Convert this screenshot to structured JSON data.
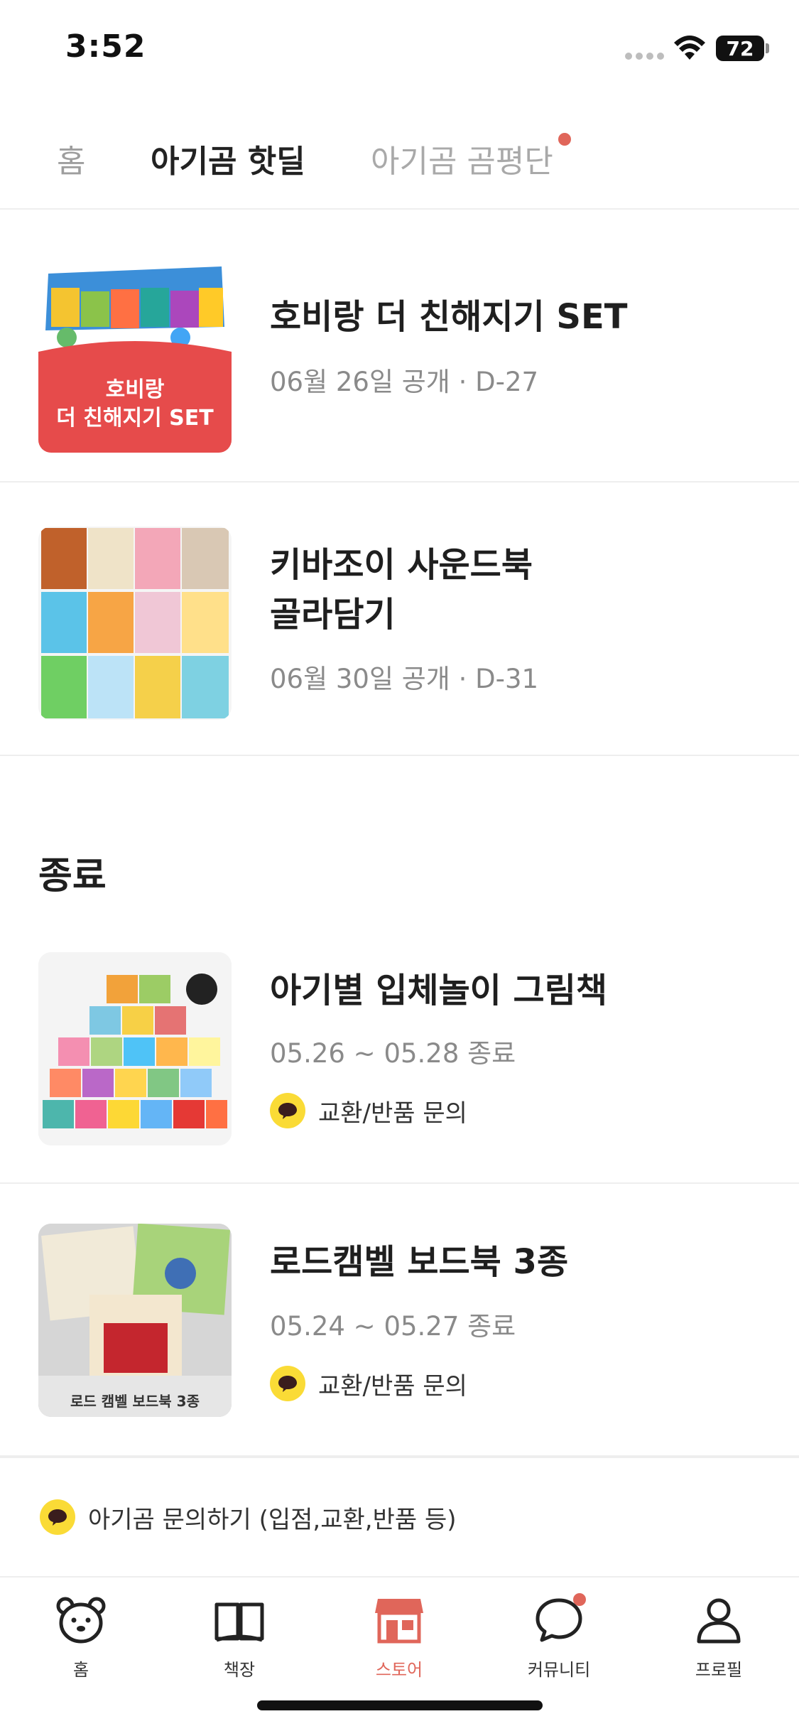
{
  "status": {
    "time": "3:52",
    "battery": "72"
  },
  "tabs": [
    {
      "label": "홈"
    },
    {
      "label": "아기곰 핫딜"
    },
    {
      "label": "아기곰 곰평단"
    }
  ],
  "upcoming": [
    {
      "thumb_text_1": "호비랑",
      "thumb_text_2": "더 친해지기 SET",
      "title": "호비랑 더 친해지기 SET",
      "subtitle": "06월 26일 공개 · D-27"
    },
    {
      "title_line1": "키바조이 사운드북",
      "title_line2": "골라담기",
      "subtitle": "06월 30일 공개 · D-31"
    }
  ],
  "ended_section": {
    "title": "종료"
  },
  "ended": [
    {
      "title": "아기별 입체놀이 그림책",
      "subtitle": "05.26 ~ 05.28 종료",
      "inquiry": "교환/반품 문의"
    },
    {
      "title": "로드캠벨 보드북 3종",
      "subtitle": "05.24 ~ 05.27 종료",
      "inquiry": "교환/반품 문의",
      "thumb_caption": "로드 캠벨 보드북 3종"
    }
  ],
  "contact": {
    "label": "아기곰 문의하기 (입점,교환,반품 등)"
  },
  "bottom_nav": [
    {
      "label": "홈",
      "icon": "bear-icon"
    },
    {
      "label": "책장",
      "icon": "book-icon"
    },
    {
      "label": "스토어",
      "icon": "store-icon"
    },
    {
      "label": "커뮤니티",
      "icon": "chat-icon"
    },
    {
      "label": "프로필",
      "icon": "profile-icon"
    }
  ],
  "colors": {
    "accent": "#e0665a",
    "kakao": "#fadb36",
    "divider": "#eeeeee"
  }
}
